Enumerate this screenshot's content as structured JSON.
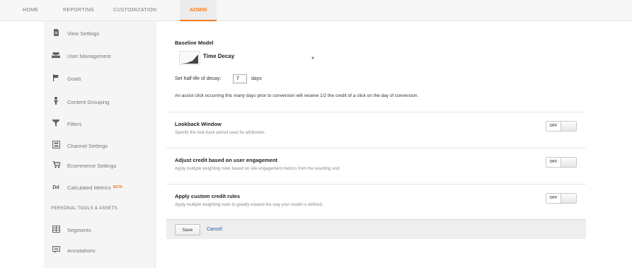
{
  "topnav": {
    "tabs": [
      {
        "label": "HOME"
      },
      {
        "label": "REPORTING"
      },
      {
        "label": "CUSTOMIZATION"
      },
      {
        "label": "ADMIN"
      }
    ],
    "active_tab": "ADMIN",
    "accent_color": "#f47a20"
  },
  "sidebar": {
    "items": [
      {
        "label": "View Settings",
        "icon": "document-icon"
      },
      {
        "label": "User Management",
        "icon": "users-icon"
      },
      {
        "label": "Goals",
        "icon": "flag-icon"
      },
      {
        "label": "Content Grouping",
        "icon": "person-icon"
      },
      {
        "label": "Filters",
        "icon": "filter-icon"
      },
      {
        "label": "Channel Settings",
        "icon": "channel-icon"
      },
      {
        "label": "Ecommerce Settings",
        "icon": "cart-icon"
      },
      {
        "label": "Calculated Metrics",
        "icon": "dd-icon",
        "badge": "BETA"
      }
    ],
    "section_heading": "PERSONAL TOOLS & ASSETS",
    "tools": [
      {
        "label": "Segments",
        "icon": "segments-icon"
      },
      {
        "label": "Annotations",
        "icon": "annotations-icon"
      }
    ]
  },
  "main": {
    "baseline_label": "Baseline Model",
    "model_name": "Time Decay",
    "halflife_label": "Set half-life of decay:",
    "halflife_value": "7",
    "halflife_unit": "days",
    "assist_note": "An assist click occurring this many days prior to conversion will receive 1/2 the credit of a click on the day of conversion.",
    "rows": [
      {
        "title": "Lookback Window",
        "desc": "Specify the look back period used for attribution.",
        "toggle": "OFF"
      },
      {
        "title": "Adjust credit based on user engagement",
        "desc": "Apply multiple weighting rules based on site engagement metrics from the resulting visit.",
        "toggle": "OFF"
      },
      {
        "title": "Apply custom credit rules",
        "desc": "Apply multiple weighting rules to greatly expand the way your model is defined.",
        "toggle": "OFF"
      }
    ],
    "save_label": "Save",
    "cancel_label": "Cancel"
  }
}
